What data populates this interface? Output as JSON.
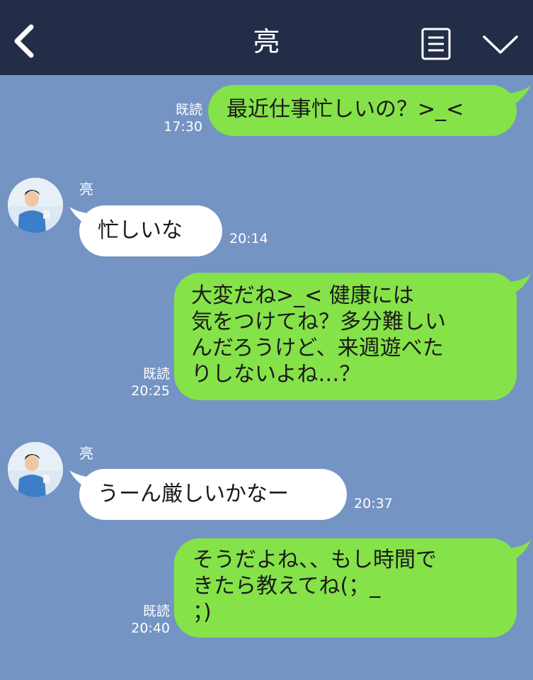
{
  "header": {
    "title": "亮",
    "back_icon": "chevron-left-icon",
    "menu_icon": "list-menu-icon",
    "dropdown_icon": "chevron-down-icon",
    "background": "#232d47"
  },
  "chat": {
    "background": "#7494c4",
    "outgoing_color": "#85e249",
    "incoming_color": "#ffffff"
  },
  "messages": [
    {
      "direction": "outgoing",
      "text": "最近仕事忙しいの？>_<",
      "read": "既読",
      "time": "17:30"
    },
    {
      "direction": "incoming",
      "sender": "亮",
      "text": "忙しいな",
      "time": "20:14"
    },
    {
      "direction": "outgoing",
      "lines": [
        "大変だね>_< 健康には",
        "気をつけてね？多分難しい",
        "んだろうけど、来週遊べた",
        "りしないよね…？"
      ],
      "read": "既読",
      "time": "20:25"
    },
    {
      "direction": "incoming",
      "sender": "亮",
      "text": "うーん厳しいかなー",
      "time": "20:37"
    },
    {
      "direction": "outgoing",
      "lines": [
        "そうだよね、、もし時間で",
        "きたら教えてね(；_",
        "；)"
      ],
      "read": "既読",
      "time": "20:40"
    }
  ]
}
